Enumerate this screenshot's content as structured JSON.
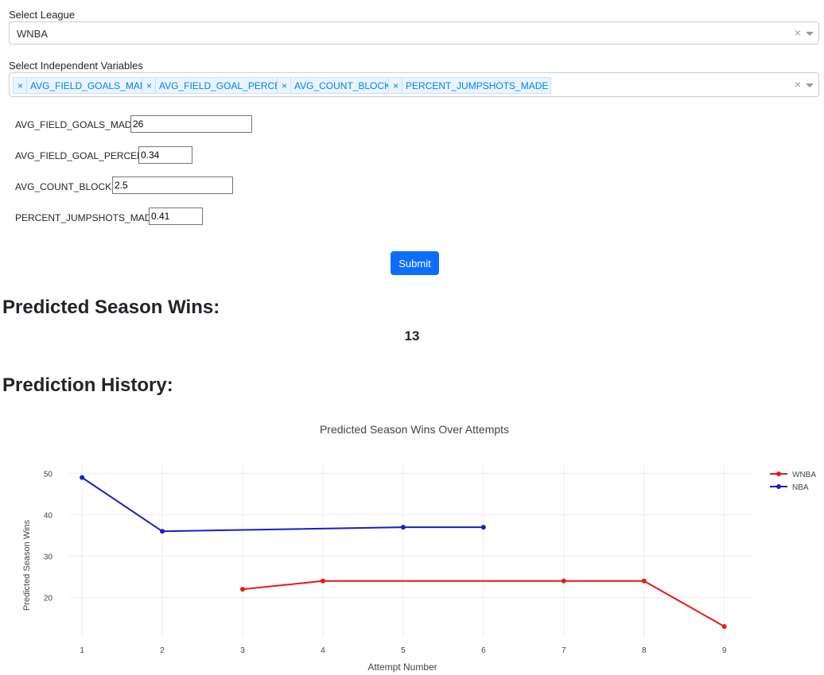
{
  "league": {
    "label": "Select League",
    "value": "WNBA",
    "clear_icon": "×"
  },
  "variables": {
    "label": "Select Independent Variables",
    "tags": [
      "AVG_FIELD_GOALS_MADE",
      "AVG_FIELD_GOAL_PERCENT",
      "AVG_COUNT_BLOCKS",
      "PERCENT_JUMPSHOTS_MADE"
    ],
    "tag_remove_icon": "×",
    "clear_icon": "×"
  },
  "inputs": [
    {
      "label": "AVG_FIELD_GOALS_MADE",
      "value": "26"
    },
    {
      "label": "AVG_FIELD_GOAL_PERCENT",
      "value": "0.34"
    },
    {
      "label": "AVG_COUNT_BLOCKS",
      "value": "2.5"
    },
    {
      "label": "PERCENT_JUMPSHOTS_MADE",
      "value": "0.41"
    }
  ],
  "submit_label": "Submit",
  "prediction": {
    "heading": "Predicted Season Wins:",
    "value": "13"
  },
  "history": {
    "heading": "Prediction History:"
  },
  "chart_data": {
    "type": "line",
    "title": "Predicted Season Wins Over Attempts",
    "xlabel": "Attempt Number",
    "ylabel": "Predicted Season Wins",
    "x_ticks": [
      1,
      2,
      3,
      4,
      5,
      6,
      7,
      8,
      9
    ],
    "y_ticks": [
      20,
      30,
      40,
      50
    ],
    "xlim": [
      0.85,
      9.35
    ],
    "ylim": [
      10.5,
      52
    ],
    "grid": true,
    "legend_position": "top-right",
    "series": [
      {
        "name": "WNBA",
        "color": "#e31a1c",
        "x": [
          3,
          4,
          7,
          8,
          9
        ],
        "y": [
          22,
          24,
          24,
          24,
          13
        ]
      },
      {
        "name": "NBA",
        "color": "#1c1cbf",
        "x": [
          1,
          2,
          5,
          6
        ],
        "y": [
          49,
          36,
          37,
          37
        ]
      }
    ]
  }
}
